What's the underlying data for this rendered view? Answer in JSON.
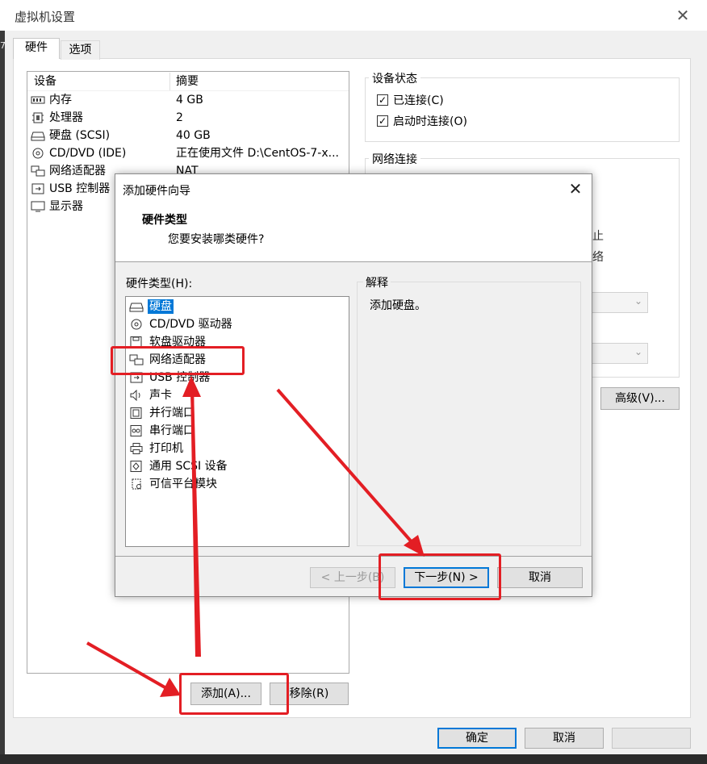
{
  "window": {
    "title": "虚拟机设置",
    "close_glyph": "✕",
    "edge_mark": "7"
  },
  "tabs": [
    {
      "label": "硬件",
      "selected": true
    },
    {
      "label": "选项",
      "selected": false
    }
  ],
  "device_list": {
    "col_device": "设备",
    "col_summary": "摘要",
    "rows": [
      {
        "name": "内存",
        "summary": "4 GB",
        "icon": "memory-icon"
      },
      {
        "name": "处理器",
        "summary": "2",
        "icon": "cpu-icon"
      },
      {
        "name": "硬盘 (SCSI)",
        "summary": "40 GB",
        "icon": "hard-disk-icon"
      },
      {
        "name": "CD/DVD (IDE)",
        "summary": "正在使用文件 D:\\CentOS-7-x...",
        "icon": "cd-dvd-icon"
      },
      {
        "name": "网络适配器",
        "summary": "NAT",
        "icon": "network-adapter-icon"
      },
      {
        "name": "USB 控制器",
        "summary": "",
        "icon": "usb-icon"
      },
      {
        "name": "显示器",
        "summary": "",
        "icon": "monitor-icon"
      }
    ],
    "add_label": "添加(A)...",
    "remove_label": "移除(R)"
  },
  "device_status": {
    "title": "设备状态",
    "connected_label": "已连接(C)",
    "connected_checked": true,
    "autoconnect_label": "启动时连接(O)",
    "autoconnect_checked": true,
    "check_glyph": "✓"
  },
  "network": {
    "title": "网络连接",
    "ghost_text_1": "止",
    "ghost_text_2": "络",
    "chevron_glyph": "⌄",
    "advanced_label": "高级(V)..."
  },
  "footer": {
    "ok_label": "确定",
    "cancel_label": "取消"
  },
  "dialog": {
    "title": "添加硬件向导",
    "close_glyph": "✕",
    "heading": "硬件类型",
    "question": "您要安装哪类硬件?",
    "list_label": "硬件类型(H):",
    "hardware_types": [
      {
        "label": "硬盘",
        "icon": "hard-disk-icon",
        "selected": true
      },
      {
        "label": "CD/DVD 驱动器",
        "icon": "cd-dvd-icon",
        "selected": false
      },
      {
        "label": "软盘驱动器",
        "icon": "floppy-icon",
        "selected": false
      },
      {
        "label": "网络适配器",
        "icon": "network-adapter-icon",
        "selected": false
      },
      {
        "label": "USB 控制器",
        "icon": "usb-icon",
        "selected": false
      },
      {
        "label": "声卡",
        "icon": "speaker-icon",
        "selected": false
      },
      {
        "label": "并行端口",
        "icon": "parallel-port-icon",
        "selected": false
      },
      {
        "label": "串行端口",
        "icon": "serial-port-icon",
        "selected": false
      },
      {
        "label": "打印机",
        "icon": "printer-icon",
        "selected": false
      },
      {
        "label": "通用 SCSI 设备",
        "icon": "scsi-icon",
        "selected": false
      },
      {
        "label": "可信平台模块",
        "icon": "tpm-icon",
        "selected": false
      }
    ],
    "explain_title": "解释",
    "explain_text": "添加硬盘。",
    "back_label": "< 上一步(B)",
    "next_label": "下一步(N) >",
    "cancel_label": "取消"
  },
  "colors": {
    "accent": "#0078d7",
    "annotation": "#e31e24"
  }
}
